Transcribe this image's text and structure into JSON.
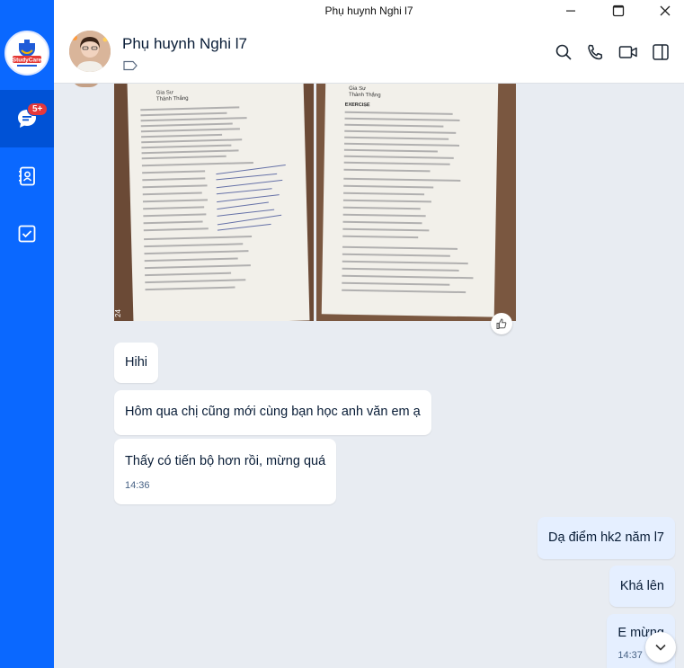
{
  "window": {
    "title": "Phụ huynh Nghi l7"
  },
  "nav": {
    "logo_text": "StudyCare",
    "chat_badge": "5+"
  },
  "header": {
    "name": "Phụ huynh Nghi l7"
  },
  "messages": [
    {
      "text": "Hihi"
    },
    {
      "text": "Hôm qua chị cũng mới cùng bạn học anh văn em ạ"
    },
    {
      "text": "Thấy có tiến bộ hơn rồi, mừng quá",
      "time": "14:36"
    },
    {
      "text": "Dạ điểm hk2 năm l7"
    },
    {
      "text": "Khá lên"
    },
    {
      "text": "E mừng",
      "time": "14:37"
    }
  ],
  "photos": {
    "left_header": "Gia Sư",
    "left_subheader": "Thành Thắng",
    "right_header": "Gia Sư",
    "right_subheader": "Thành Thắng",
    "right_section": "EXERCISE",
    "page_number": "24"
  },
  "colors": {
    "nav_bg": "#0a68ff",
    "nav_active": "#0052d6",
    "badge": "#e5383b",
    "my_bubble": "#e5efff",
    "chat_bg": "#e8ecf2"
  }
}
